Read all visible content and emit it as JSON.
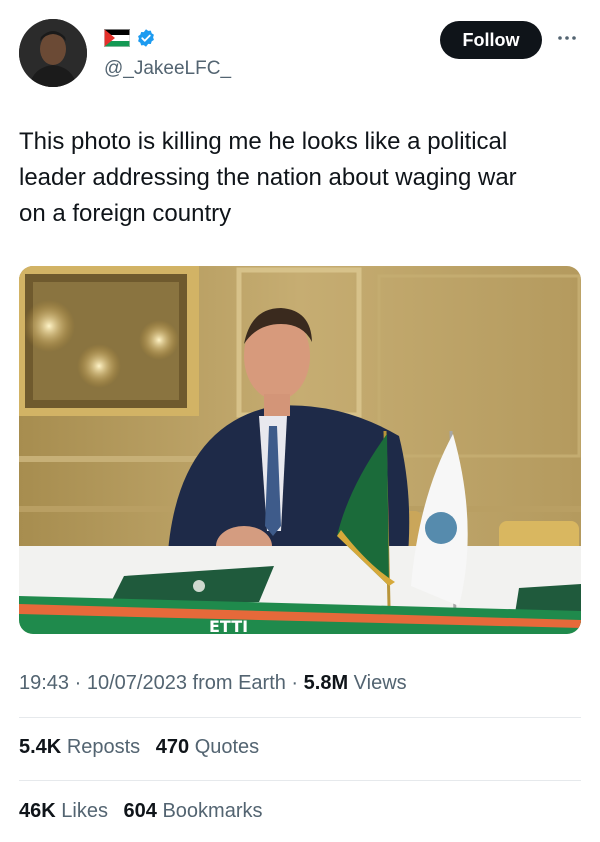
{
  "user": {
    "handle": "@_JakeeLFC_",
    "avatar_icon": "avatar-photo",
    "flag_icon": "palestine-flag-icon",
    "verified_icon": "verified-badge-icon",
    "verified_color": "#1d9bf0"
  },
  "actions": {
    "follow_label": "Follow",
    "more_icon": "more-options-icon"
  },
  "tweet": {
    "text_lines": [
      "This photo is killing me he looks like a political",
      "leader addressing the nation about waging war",
      "on a foreign country"
    ]
  },
  "media": {
    "scarf_text": "ETTI"
  },
  "meta": {
    "time": "19:43",
    "sep1": " · ",
    "date": "10/07/2023",
    "source": " from Earth",
    "sep2": " · ",
    "views_count": "5.8M",
    "views_label": " Views"
  },
  "engagement": {
    "reposts_count": "5.4K",
    "reposts_label": "Reposts",
    "quotes_count": "470",
    "quotes_label": "Quotes",
    "likes_count": "46K",
    "likes_label": "Likes",
    "bookmarks_count": "604",
    "bookmarks_label": "Bookmarks"
  },
  "colors": {
    "text_primary": "#0f1419",
    "text_secondary": "#536471",
    "follow_bg": "#0f1419"
  }
}
